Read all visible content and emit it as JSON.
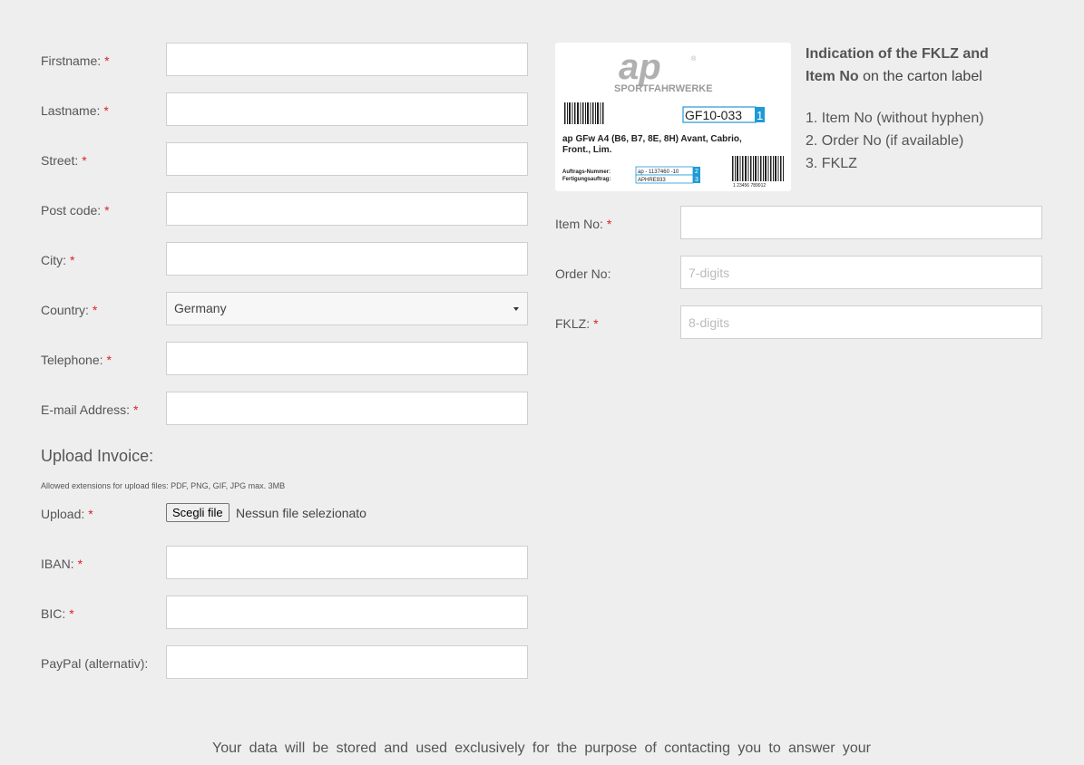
{
  "form": {
    "fields": [
      {
        "label": "Firstname:",
        "required": true,
        "value": ""
      },
      {
        "label": "Lastname:",
        "required": true,
        "value": ""
      },
      {
        "label": "Street:",
        "required": true,
        "value": ""
      },
      {
        "label": "Post code:",
        "required": true,
        "value": ""
      },
      {
        "label": "City:",
        "required": true,
        "value": ""
      },
      {
        "label": "Country:",
        "required": true,
        "value": "Germany"
      },
      {
        "label": "Telephone:",
        "required": true,
        "value": ""
      },
      {
        "label": "E-mail Address:",
        "required": true,
        "value": ""
      }
    ],
    "upload_section": {
      "title": "Upload Invoice:",
      "note": "Allowed extensions for upload files: PDF, PNG, GIF, JPG max. 3MB",
      "label": "Upload:",
      "button": "Scegli file",
      "status": "Nessun file selezionato"
    },
    "bank_fields": [
      {
        "label": "IBAN:",
        "required": true,
        "value": ""
      },
      {
        "label": "BIC:",
        "required": true,
        "value": ""
      },
      {
        "label": "PayPal (alternativ):",
        "required": false,
        "value": ""
      }
    ],
    "required_marker": "*"
  },
  "carton_label": {
    "logo_text": "ap",
    "logo_sub": "SPORTFAHRWERKE",
    "code": "GF10-033",
    "code_marker": "1",
    "product": "ap GFw A4 (B6, B7, 8E, 8H) Avant, Cabrio, Front., Lim.",
    "auftrags_label": "Auftrags-Nummer:",
    "auftrags_value": "ap - 1137460 -10",
    "auftrags_marker": "2",
    "fertigung_label": "Fertigungsauftrag:",
    "fertigung_value": "APHRE933",
    "fertigung_marker": "3",
    "barcode_number": "1 23456 789012"
  },
  "info": {
    "title_bold_1": "Indication of the FKLZ and",
    "title_bold_2": "Item No",
    "title_rest": " on the carton label",
    "list": [
      "1. Item No (without hyphen)",
      "2. Order No (if available)",
      "3. FKLZ"
    ]
  },
  "product_fields": [
    {
      "label": "Item No:",
      "required": true,
      "placeholder": ""
    },
    {
      "label": "Order No:",
      "required": false,
      "placeholder": "7-digits"
    },
    {
      "label": "FKLZ:",
      "required": true,
      "placeholder": "8-digits"
    }
  ],
  "footer": {
    "text": "Your data will be stored and used exclusively for the purpose of contacting you to answer your"
  }
}
